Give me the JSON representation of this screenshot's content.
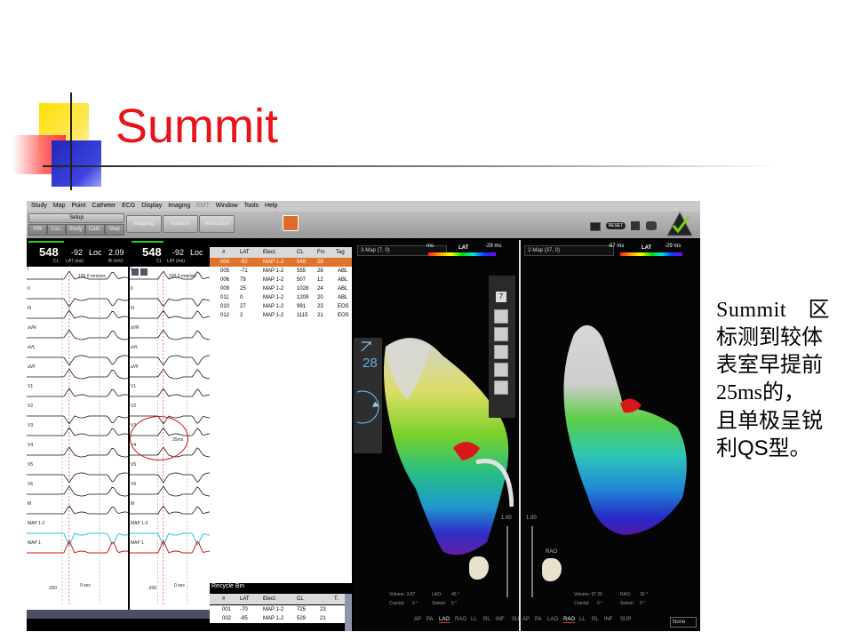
{
  "slide": {
    "title": "Summit",
    "side_text": [
      "Summit　区",
      "标测到较体",
      "表室早提前",
      "25ms的，",
      "且单极呈锐",
      "利QS型。"
    ]
  },
  "app": {
    "menu": [
      "Study",
      "Map",
      "Point",
      "Catheter",
      "ECG",
      "Display",
      "Imaging",
      "EMT",
      "Window",
      "Tools",
      "Help"
    ],
    "toolbar": {
      "setup": "Setup",
      "tabs": [
        "HW",
        "Loc.",
        "Study",
        "Cath.",
        "Map"
      ],
      "mapping": "Mapping",
      "ablation": "Ablation",
      "verification": "Verification",
      "reset_label": "RESET"
    },
    "ecg_left": {
      "cl": "548",
      "lat": "-92",
      "loc_label": "Loc",
      "bi": "2.09",
      "cl_label": "CL",
      "lat_label": "LAT (ms)",
      "bi_label": "Bi (mV)",
      "speed": "100.0 mm/sec",
      "leads": [
        "I",
        "II",
        "III",
        "aVR",
        "aVL",
        "aVF",
        "V1",
        "V2",
        "V3",
        "V4",
        "V5",
        "V6",
        "M",
        "MAP 1-2",
        "MAP 1"
      ],
      "axis_left": "-200",
      "axis_right": "0 sec"
    },
    "ecg_right": {
      "cl": "548",
      "lat": "-92",
      "loc_label": "Loc",
      "cl_label": "CL",
      "lat_label": "LAT (ms)",
      "speed": "100.0 mm/sec",
      "leads": [
        "I",
        "II",
        "III",
        "aVR",
        "aVL",
        "aVF",
        "V1",
        "V2",
        "V3",
        "V4",
        "V5",
        "V6",
        "M",
        "MAP 1-2",
        "MAP 1"
      ],
      "annot": "25ms",
      "axis_left": "-200",
      "axis_right": "0 sec"
    },
    "points_table": {
      "headers": [
        "#",
        "LAT",
        "Elect.",
        "CL",
        "Frc",
        "Tag"
      ],
      "rows": [
        [
          "004",
          "-92",
          "MAP 1-2",
          "548",
          "28",
          ""
        ],
        [
          "005",
          "-71",
          "MAP 1-2",
          "555",
          "28",
          "ABL"
        ],
        [
          "006",
          "79",
          "MAP 1-2",
          "507",
          "12",
          "ABL"
        ],
        [
          "009",
          "25",
          "MAP 1-2",
          "1028",
          "24",
          "ABL"
        ],
        [
          "011",
          "0",
          "MAP 1-2",
          "1209",
          "20",
          "ABL"
        ],
        [
          "010",
          "27",
          "MAP 1-2",
          "991",
          "23",
          "EOS"
        ],
        [
          "012",
          "2",
          "MAP 1-2",
          "1115",
          "21",
          "EOS"
        ]
      ],
      "selected_index": 0
    },
    "recycle_bin": {
      "title": "Recycle Bin",
      "headers": [
        "#",
        "LAT",
        "Elect.",
        "CL",
        "T."
      ],
      "rows": [
        [
          "001",
          "-70",
          "MAP 1-2",
          "725",
          "23"
        ],
        [
          "002",
          "-85",
          "MAP 1-2",
          "529",
          "21"
        ]
      ]
    },
    "map1": {
      "selector": "3-Map (7, 0)",
      "lat_label": "LAT",
      "lat_min": "ms",
      "lat_max": "-29 ms",
      "side_value": "28",
      "slider_label": "1.00",
      "tool_number": "7",
      "stats": {
        "volume": "Volume: 3.87",
        "lao": "LAO:",
        "lao_val": "45 °",
        "cranial": "Cranial:",
        "cranial_val": "0 °",
        "swivel": "Swivel:",
        "swivel_val": "0 °"
      },
      "views": [
        "AP",
        "PA",
        "LAO",
        "RAO",
        "LL",
        "RL",
        "INF",
        "SUP"
      ],
      "active_view": "LAO"
    },
    "map2": {
      "selector": "2-Map (37, 0)",
      "lat_label": "LAT",
      "lat_min": "-87 ms",
      "lat_max": "-29 ms",
      "slider_label": "1.00",
      "view_label": "RAO",
      "stats": {
        "volume": "Volume: 97.26",
        "rao": "RAO:",
        "rao_val": "30 °",
        "cranial": "Cranial:",
        "cranial_val": "0 °",
        "swivel": "Swivel:",
        "swivel_val": "0 °"
      },
      "views": [
        "AP",
        "PA",
        "LAO",
        "RAO",
        "LL",
        "RL",
        "INF",
        "SUP"
      ],
      "active_view": "RAO",
      "none_select": "None"
    }
  }
}
